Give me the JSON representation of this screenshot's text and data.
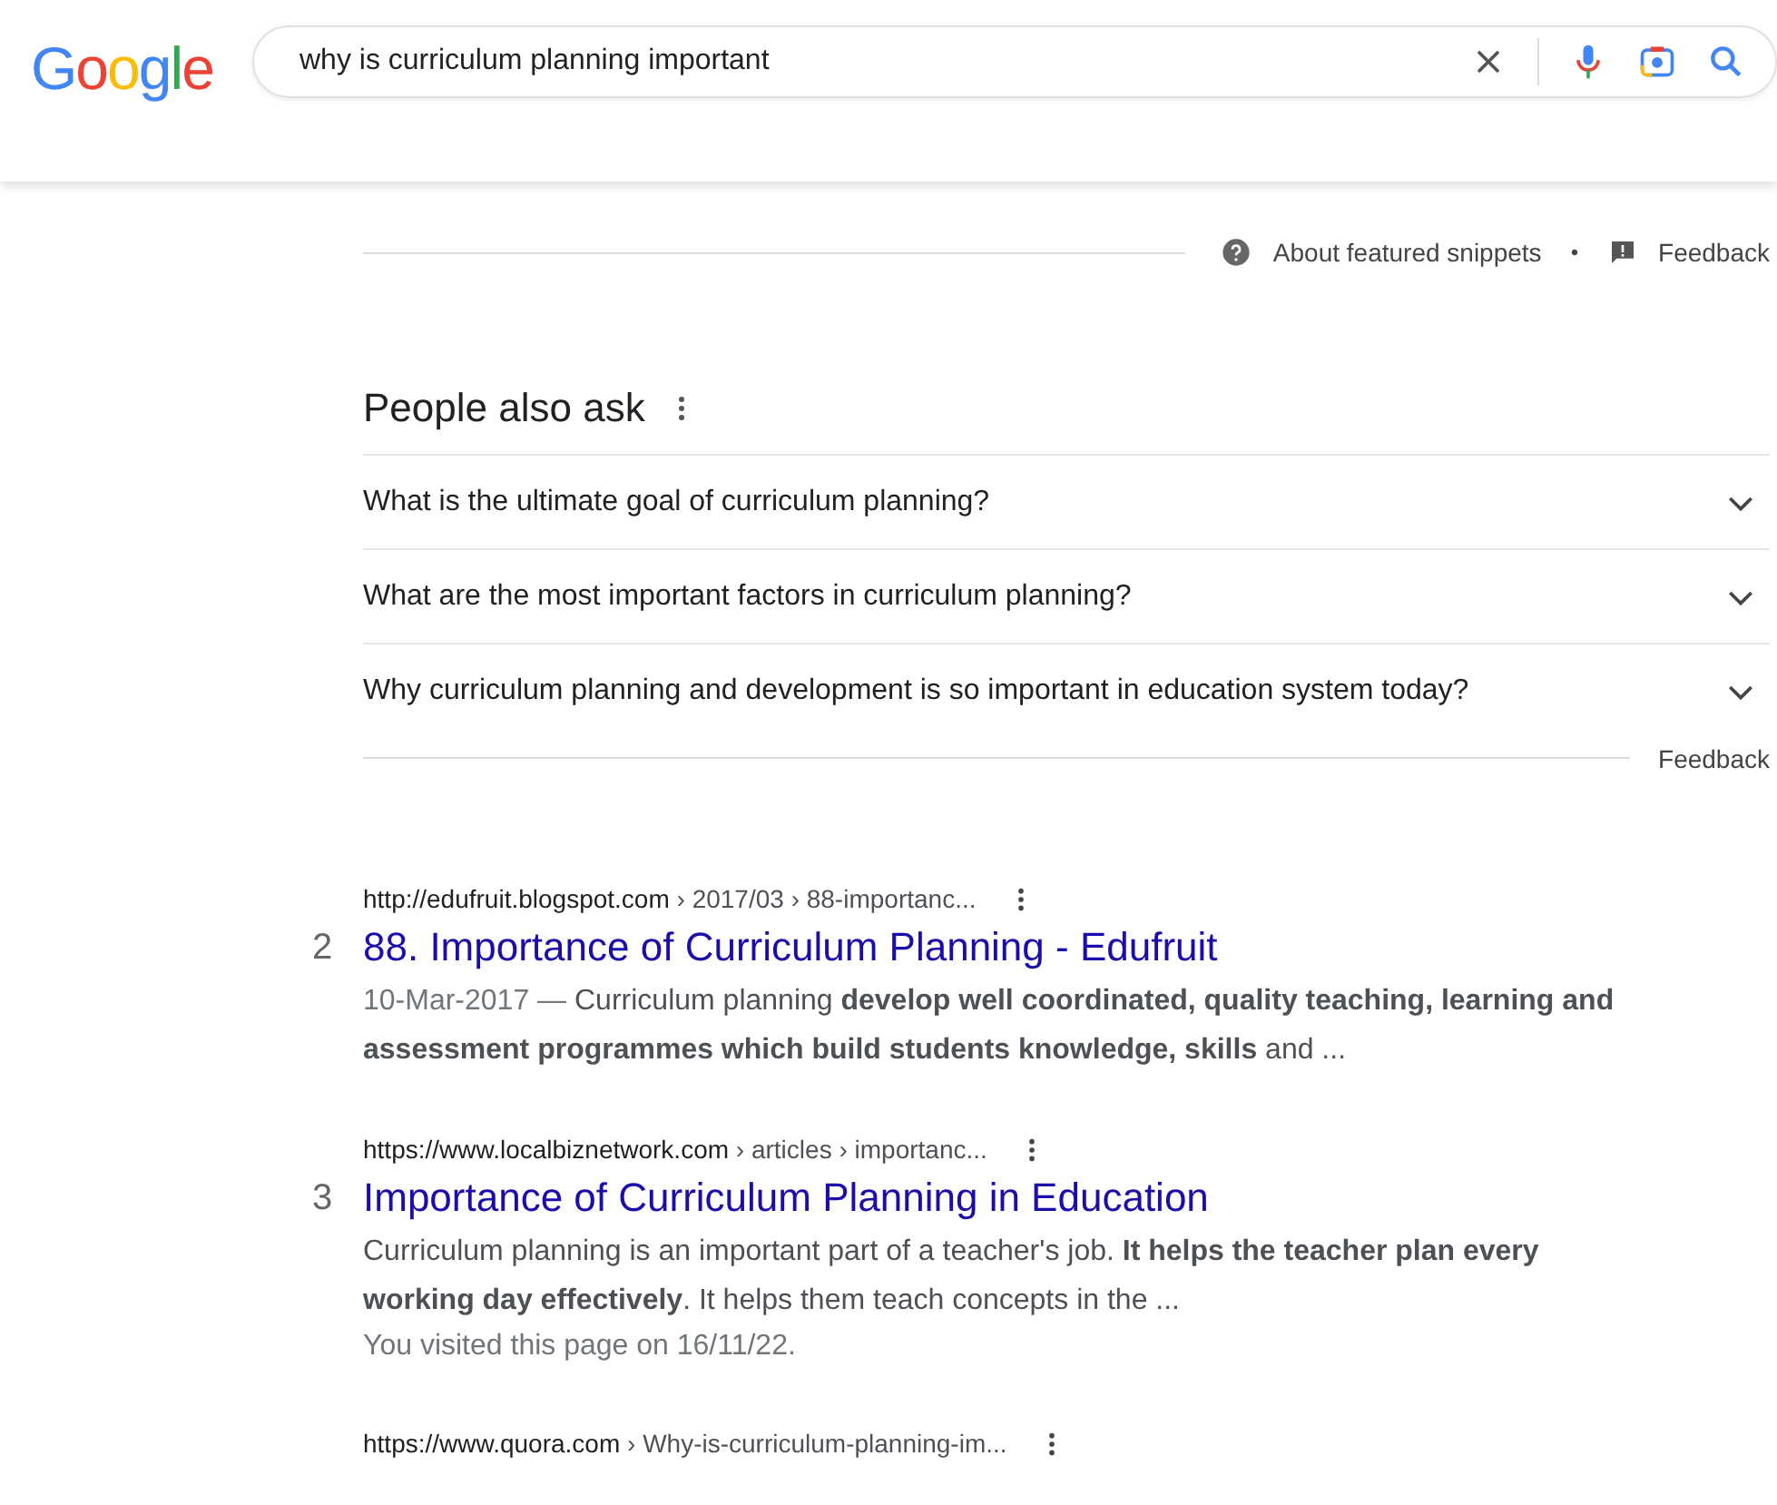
{
  "header": {
    "logo": "Google",
    "search": {
      "value": "why is curriculum planning important"
    }
  },
  "featured_footer": {
    "about": "About featured snippets",
    "separator": "•",
    "feedback": "Feedback"
  },
  "people_also_ask": {
    "title": "People also ask",
    "questions": [
      {
        "text": "What is the ultimate goal of curriculum planning?",
        "expanded": false
      },
      {
        "text": "What are the most important factors in curriculum planning?",
        "expanded": false
      },
      {
        "text": "Why curriculum planning and development is so important in education system today?",
        "expanded": false
      }
    ],
    "feedback": "Feedback"
  },
  "results": [
    {
      "number": "2",
      "domain": "http://edufruit.blogspot.com",
      "path": " › 2017/03 › 88-importanc...",
      "title": "88. Importance of Curriculum Planning - Edufruit",
      "date": "10-Mar-2017 — ",
      "snippet": "Curriculum planning **develop well coordinated, quality teaching, learning and assessment programmes which build students knowledge, skills** and ..."
    },
    {
      "number": "3",
      "domain": "https://www.localbiznetwork.com",
      "path": " › articles › importanc...",
      "title": "Importance of Curriculum Planning in Education",
      "snippet": "Curriculum planning is an important part of a teacher's job. **It helps the teacher plan every working day effectively**. It helps them teach concepts in the ...",
      "visited": "You visited this page on 16/11/22."
    },
    {
      "domain": "https://www.quora.com",
      "path": " › Why-is-curriculum-planning-im..."
    }
  ]
}
